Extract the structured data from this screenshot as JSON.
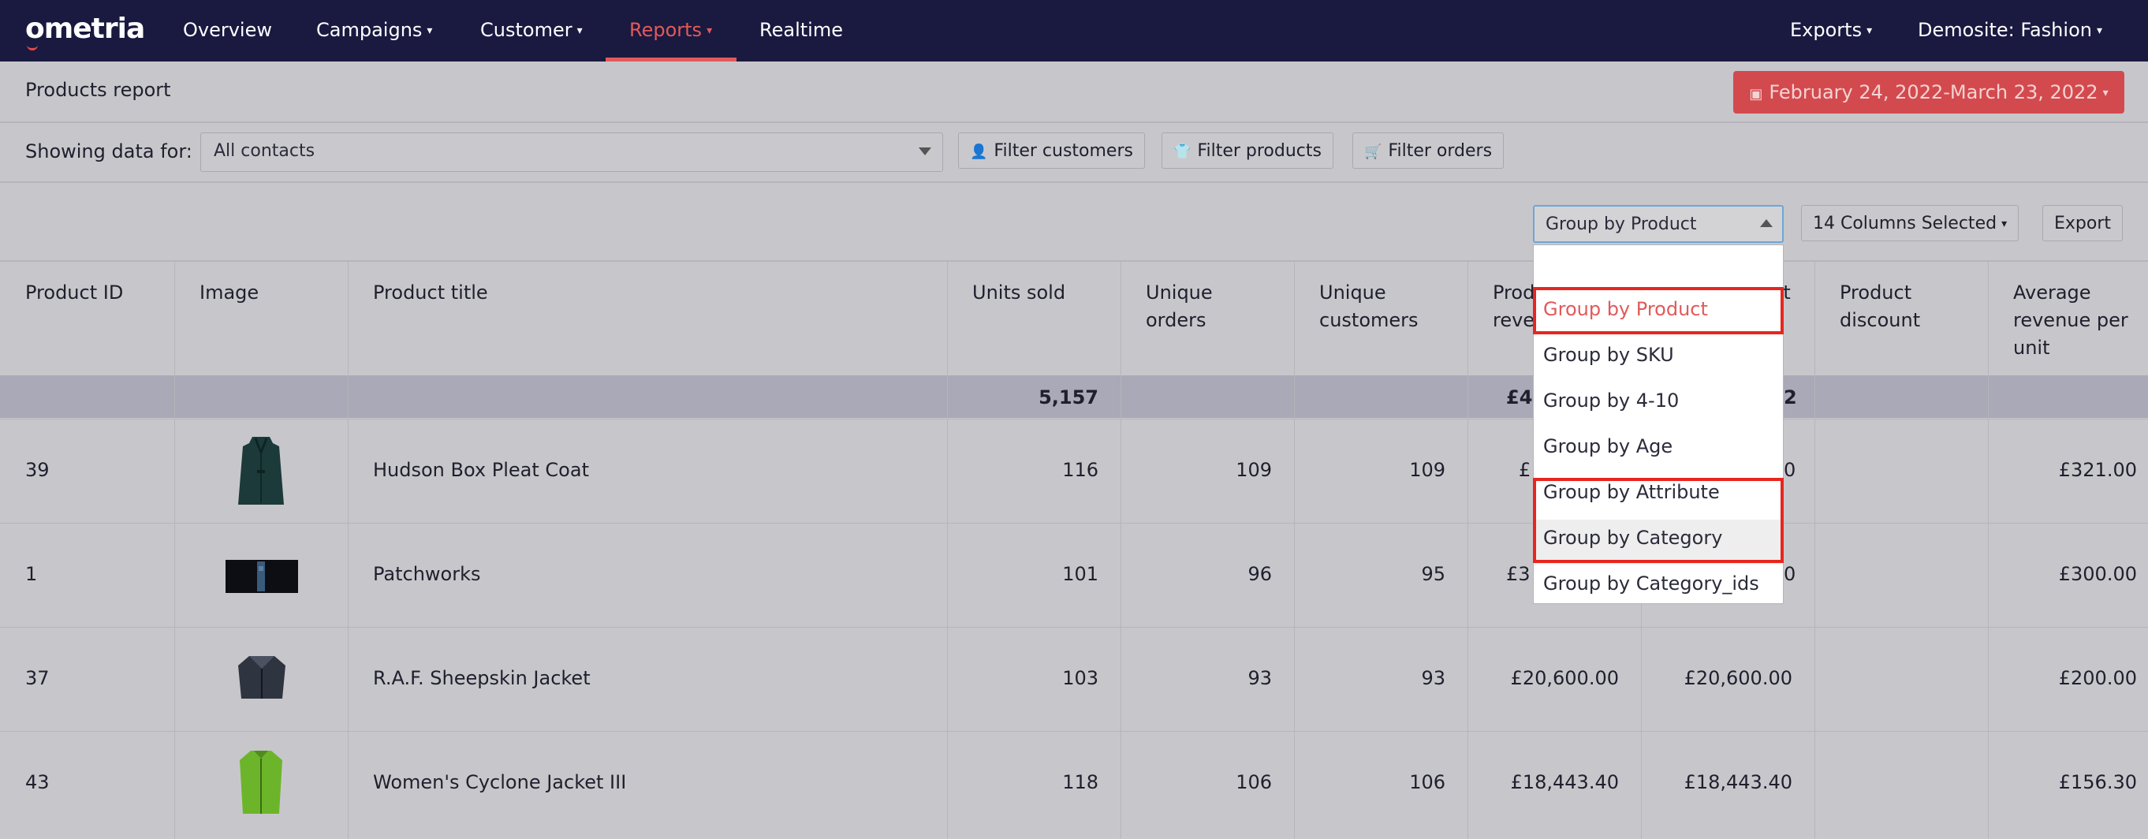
{
  "nav": {
    "logo": "ometria",
    "items": [
      {
        "label": "Overview"
      },
      {
        "label": "Campaigns",
        "caret": "▾"
      },
      {
        "label": "Customer",
        "caret": "▾"
      },
      {
        "label": "Reports",
        "caret": "▾"
      },
      {
        "label": "Realtime"
      }
    ],
    "right_items": [
      {
        "label": "Exports",
        "caret": "▾"
      },
      {
        "label": "Demosite: Fashion",
        "caret": "▾"
      }
    ]
  },
  "header": {
    "title": "Products report",
    "date_range": "February 24, 2022-March 23, 2022",
    "calendar_icon": "▣",
    "caret": "▾"
  },
  "filters": {
    "showing_label": "Showing data for:",
    "contacts_value": "All contacts",
    "buttons": [
      {
        "icon": "👤",
        "label": "Filter customers"
      },
      {
        "icon": "👕",
        "label": "Filter products"
      },
      {
        "icon": "🛒",
        "label": "Filter orders"
      }
    ]
  },
  "toolbar": {
    "group_by_value": "Group by Product",
    "columns_label": "14 Columns Selected",
    "columns_caret": "▾",
    "export_label": "Export"
  },
  "dropdown": {
    "blank": "",
    "options": [
      {
        "label": "Group by Product",
        "selected": true
      },
      {
        "label": "Group by SKU"
      },
      {
        "label": "Group by 4-10"
      },
      {
        "label": "Group by Age"
      },
      {
        "label": "Group by Attribute"
      },
      {
        "label": "Group by Category"
      },
      {
        "label": "Group by Category_ids"
      }
    ]
  },
  "table": {
    "headers": {
      "product_id": "Product ID",
      "image": "Image",
      "product_title": "Product title",
      "units_sold": "Units sold",
      "unique_orders_1": "Unique",
      "unique_orders_2": "orders",
      "unique_customers_1": "Unique",
      "unique_customers_2": "customers",
      "product_revenue_1": "Prod",
      "product_revenue_2": "reve",
      "product_discount_1": "Product",
      "product_discount_2": "discount",
      "avg_rev_1": "Average",
      "avg_rev_2": "revenue per",
      "avg_rev_3": "unit",
      "hidden_col": "uct"
    },
    "totals": {
      "units_sold": "5,157",
      "product_revenue": "£46",
      "col_b": "2"
    },
    "rows": [
      {
        "id": "39",
        "title": "Hudson Box Pleat Coat",
        "units": "116",
        "orders": "109",
        "customers": "109",
        "rev": "£",
        "col_b": "0",
        "avg": "£321.00"
      },
      {
        "id": "1",
        "title": "Patchworks",
        "units": "101",
        "orders": "96",
        "customers": "95",
        "rev": "£3",
        "col_b": "0",
        "avg": "£300.00"
      },
      {
        "id": "37",
        "title": "R.A.F. Sheepskin Jacket",
        "units": "103",
        "orders": "93",
        "customers": "93",
        "rev": "£20,600.00",
        "col_b": "£20,600.00",
        "avg": "£200.00"
      },
      {
        "id": "43",
        "title": "Women's Cyclone Jacket III",
        "units": "118",
        "orders": "106",
        "customers": "106",
        "rev": "£18,443.40",
        "col_b": "£18,443.40",
        "avg": "£156.30"
      }
    ]
  },
  "colors": {
    "navbar": "#1a1940",
    "accent": "#e15a5a",
    "highlight_box": "#e8251f"
  }
}
